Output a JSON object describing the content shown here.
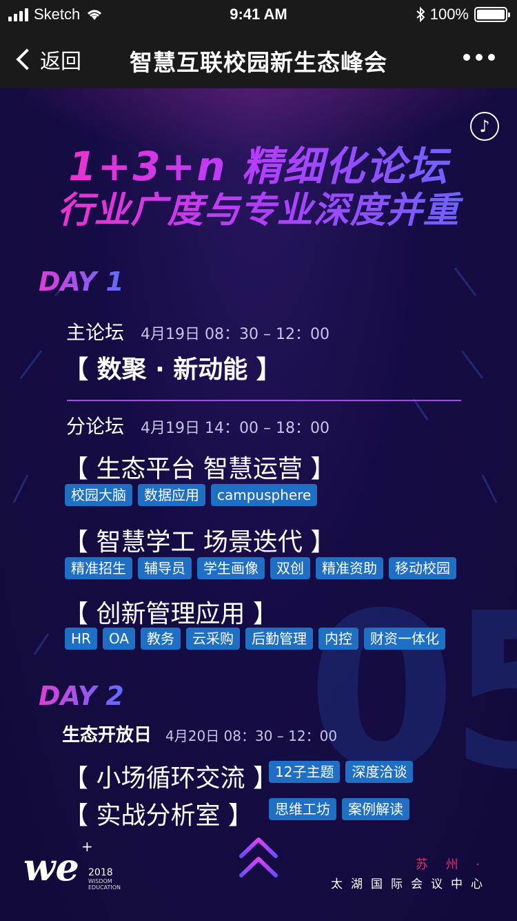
{
  "status_bar": {
    "carrier": "Sketch",
    "time": "9:41 AM",
    "battery": "100%"
  },
  "nav": {
    "back_label": "返回",
    "title": "智慧互联校园新生态峰会"
  },
  "hero": {
    "line1": "1+3+n 精细化论坛",
    "line2": "行业广度与专业深度并重"
  },
  "day1": {
    "label": "DAY 1",
    "main_forum": {
      "label": "主论坛",
      "time": "4月19日 08：30 – 12：00",
      "theme": "【 数聚 · 新动能 】"
    },
    "sub_forum": {
      "label": "分论坛",
      "time": "4月19日 14：00 – 18：00"
    },
    "tracks": [
      {
        "title": "【 生态平台 智慧运营 】",
        "tags": [
          "校园大脑",
          "数据应用",
          "campusphere"
        ]
      },
      {
        "title": "【 智慧学工 场景迭代 】",
        "tags": [
          "精准招生",
          "辅导员",
          "学生画像",
          "双创",
          "精准资助",
          "移动校园"
        ]
      },
      {
        "title": "【 创新管理应用 】",
        "tags": [
          "HR",
          "OA",
          "教务",
          "云采购",
          "后勤管理",
          "内控",
          "财资一体化"
        ]
      }
    ]
  },
  "day2": {
    "label": "DAY 2",
    "open_day": {
      "label": "生态开放日",
      "time": "4月20日 08：30 – 12：00"
    },
    "sessions": [
      {
        "title": "【 小场循环交流 】",
        "tags": [
          "12子主题",
          "深度洽谈"
        ]
      },
      {
        "title": "【 实战分析室 】",
        "tags": [
          "思维工坊",
          "案例解读"
        ]
      }
    ]
  },
  "decor": {
    "page_number": "05"
  },
  "footer": {
    "logo": "we",
    "year": "2018",
    "logo_sub": "WISDOM EDUCATION",
    "city": "苏 州 ·",
    "venue": "太湖国际会议中心"
  },
  "colors": {
    "accent_pink": "#ff2fbf",
    "accent_blue": "#5a6dff",
    "tag_bg": "#1f6fc5",
    "bg": "#120a3a"
  }
}
